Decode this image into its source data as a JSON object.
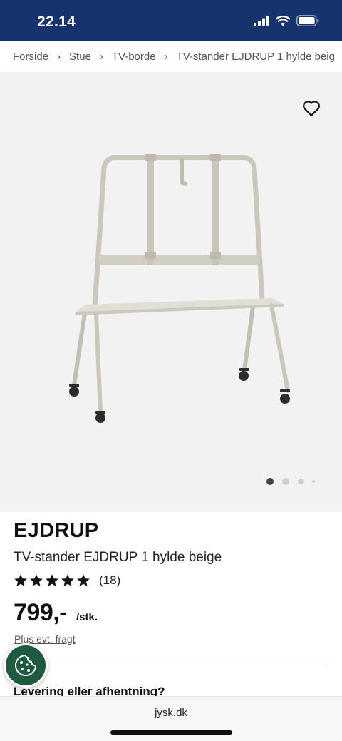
{
  "status_bar": {
    "time": "22.14",
    "icons": [
      "signal-icon",
      "wifi-icon",
      "battery-icon"
    ],
    "background": "#16336e"
  },
  "breadcrumb": {
    "items": [
      "Forside",
      "Stue",
      "TV-borde",
      "TV-stander EJDRUP 1 hylde beig"
    ],
    "separator": "›"
  },
  "gallery": {
    "image": "tv-stand-product-image",
    "favorite_icon": "heart-icon",
    "page_indicator": {
      "total": 4,
      "active": 1
    }
  },
  "product": {
    "brand": "EJDRUP",
    "title": "TV-stander EJDRUP 1 hylde beige",
    "rating": {
      "stars": 5,
      "max": 5,
      "count": "(18)"
    },
    "price": "799,-",
    "unit": "/stk.",
    "shipping_note": "Plus evt. fragt",
    "delivery_heading": "Levering eller afhentning?"
  },
  "cookie_button": {
    "icon": "cookie-icon",
    "color": "#1d5a3e"
  },
  "browser": {
    "url": "jysk.dk"
  }
}
